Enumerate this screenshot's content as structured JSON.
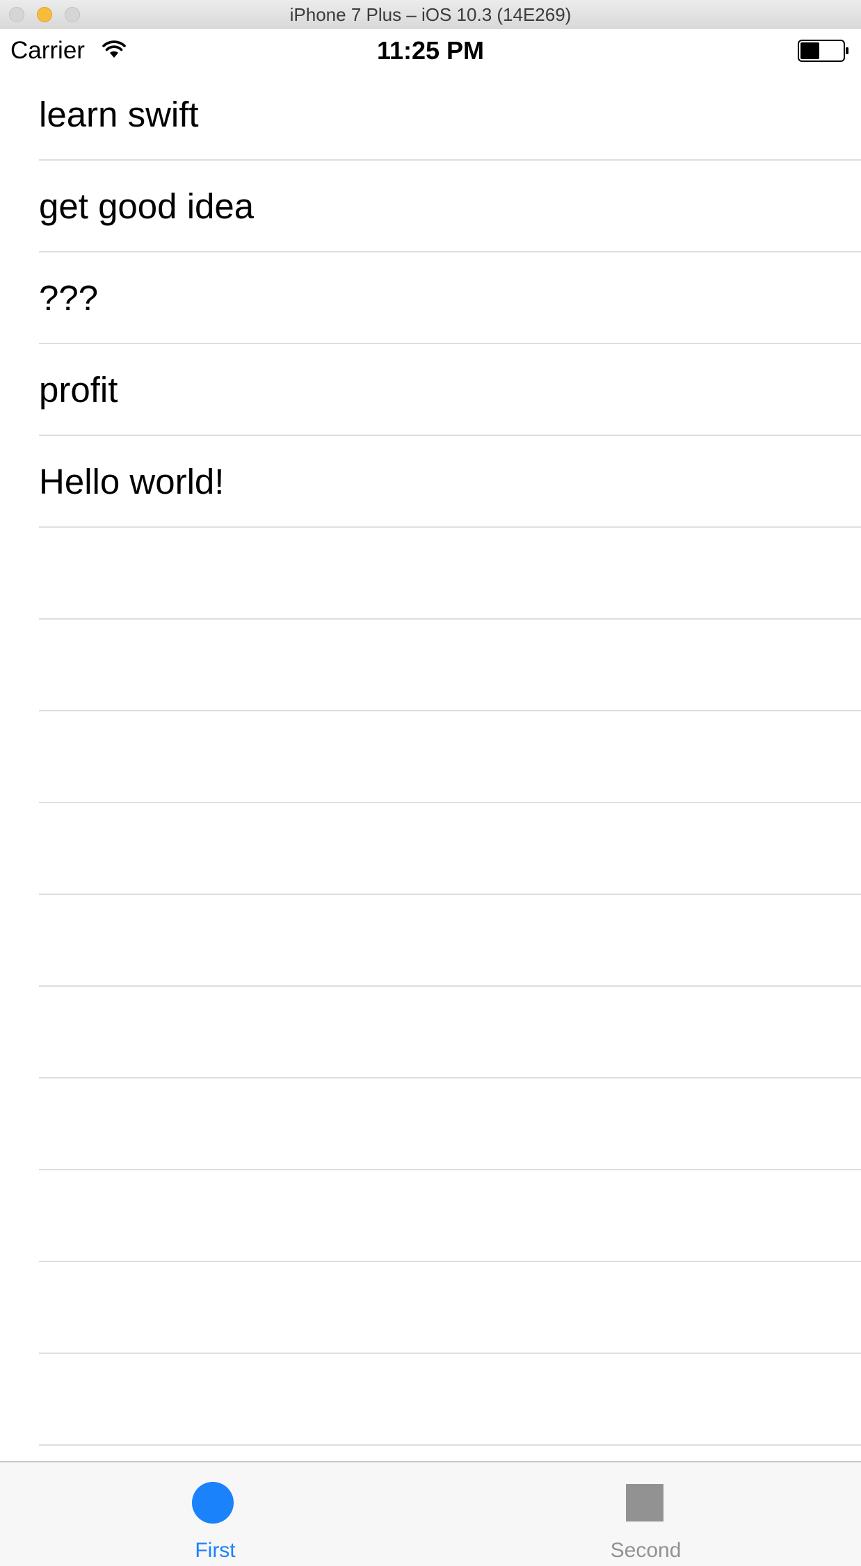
{
  "window": {
    "title": "iPhone 7 Plus – iOS 10.3 (14E269)"
  },
  "status_bar": {
    "carrier": "Carrier",
    "time": "11:25 PM",
    "icons": [
      "wifi-icon",
      "battery-icon"
    ],
    "battery_level": 0.45
  },
  "table": {
    "items": [
      {
        "label": "learn swift"
      },
      {
        "label": "get good idea"
      },
      {
        "label": "???"
      },
      {
        "label": "profit"
      },
      {
        "label": "Hello world!"
      },
      {
        "label": ""
      },
      {
        "label": ""
      },
      {
        "label": ""
      },
      {
        "label": ""
      },
      {
        "label": ""
      },
      {
        "label": ""
      },
      {
        "label": ""
      },
      {
        "label": ""
      },
      {
        "label": ""
      },
      {
        "label": ""
      }
    ]
  },
  "tab_bar": {
    "tabs": [
      {
        "label": "First",
        "icon": "circle-icon",
        "selected": true
      },
      {
        "label": "Second",
        "icon": "square-icon",
        "selected": false
      }
    ]
  },
  "colors": {
    "accent": "#1a82fb",
    "inactive": "#929292",
    "separator": "#dedede",
    "tabbar_background": "#f7f7f7"
  }
}
